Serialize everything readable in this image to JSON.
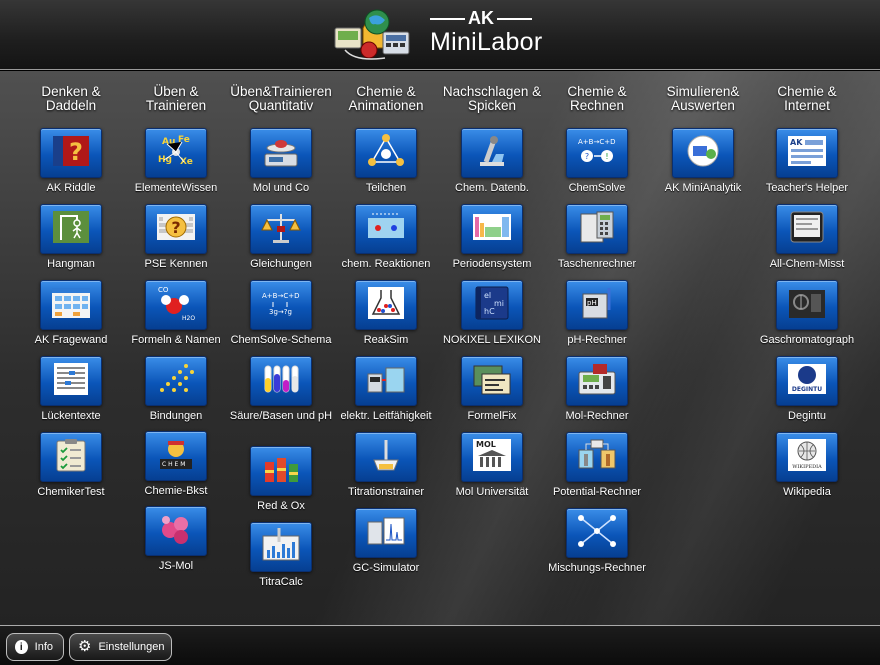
{
  "header": {
    "brand_ak": "AK",
    "brand_title": "MiniLabor"
  },
  "columns": [
    {
      "title": "Denken &\nDaddeln",
      "items": [
        {
          "label": "AK Riddle",
          "icon": "riddle-icon"
        },
        {
          "label": "Hangman",
          "icon": "hangman-icon"
        },
        {
          "label": "AK Fragewand",
          "icon": "question-wall-icon"
        },
        {
          "label": "Lückentexte",
          "icon": "cloze-text-icon"
        },
        {
          "label": "ChemikerTest",
          "icon": "clipboard-test-icon"
        }
      ]
    },
    {
      "title": "Üben &\nTrainieren",
      "items": [
        {
          "label": "ElementeWissen",
          "icon": "elements-icon"
        },
        {
          "label": "PSE Kennen",
          "icon": "pse-question-icon"
        },
        {
          "label": "Formeln & Namen",
          "icon": "molecule-formula-icon"
        },
        {
          "label": "Bindungen",
          "icon": "bonds-icon"
        },
        {
          "label": "Chemie-Bkst",
          "icon": "chem-letters-icon"
        },
        {
          "label": "JS-Mol",
          "icon": "molecule-icon"
        }
      ]
    },
    {
      "title": "Üben&Trainieren\nQuantitativ",
      "items": [
        {
          "label": "Mol und Co",
          "icon": "scale-icon"
        },
        {
          "label": "Gleichungen",
          "icon": "balance-icon"
        },
        {
          "label": "ChemSolve-Schema",
          "icon": "equation-scheme-icon"
        },
        {
          "label": "Säure/Basen und pH",
          "icon": "test-tubes-icon"
        },
        {
          "label": "Red & Ox",
          "icon": "cylinders-icon"
        },
        {
          "label": "TitraCalc",
          "icon": "titration-calc-icon"
        }
      ]
    },
    {
      "title": "Chemie &\nAnimationen",
      "items": [
        {
          "label": "Teilchen",
          "icon": "particles-icon"
        },
        {
          "label": "chem. Reaktionen",
          "icon": "reaction-icon"
        },
        {
          "label": "ReakSim",
          "icon": "flask-icon"
        },
        {
          "label": "elektr. Leitfähigkeit",
          "icon": "conductivity-icon"
        },
        {
          "label": "Titrationstrainer",
          "icon": "burette-icon"
        },
        {
          "label": "GC-Simulator",
          "icon": "gc-simulator-icon"
        }
      ]
    },
    {
      "title": "Nachschlagen &\nSpicken",
      "items": [
        {
          "label": "Chem. Datenb.",
          "icon": "microscope-icon"
        },
        {
          "label": "Periodensystem",
          "icon": "periodic-table-icon"
        },
        {
          "label": "NOKIXEL LEXIKON",
          "icon": "lexicon-book-icon"
        },
        {
          "label": "FormelFix",
          "icon": "formula-cards-icon"
        },
        {
          "label": "Mol Universität",
          "icon": "university-icon"
        }
      ]
    },
    {
      "title": "Chemie &\nRechnen",
      "items": [
        {
          "label": "ChemSolve",
          "icon": "chemsolve-icon"
        },
        {
          "label": "Taschenrechner",
          "icon": "calculator-icon"
        },
        {
          "label": "pH-Rechner",
          "icon": "ph-meter-icon"
        },
        {
          "label": "Mol-Rechner",
          "icon": "mol-calculator-icon"
        },
        {
          "label": "Potential-Rechner",
          "icon": "potential-icon"
        },
        {
          "label": "Mischungs-Rechner",
          "icon": "mixing-cross-icon"
        }
      ]
    },
    {
      "title": "Simulieren&\nAuswerten",
      "items": [
        {
          "label": "AK MiniAnalytik",
          "icon": "analytics-icon"
        }
      ]
    },
    {
      "title": "Chemie &\nInternet",
      "items": [
        {
          "label": "Teacher's Helper",
          "icon": "teachers-helper-icon"
        },
        {
          "label": "All-Chem-Misst",
          "icon": "tablet-icon"
        },
        {
          "label": "Gaschromatograph",
          "icon": "gas-chromatograph-icon"
        },
        {
          "label": "Degintu",
          "icon": "degintu-logo-icon"
        },
        {
          "label": "Wikipedia",
          "icon": "wikipedia-icon"
        }
      ]
    }
  ],
  "footer": {
    "info_label": "Info",
    "settings_label": "Einstellungen"
  },
  "colors": {
    "tile_top": "#3a8de8",
    "tile_bottom": "#063f91",
    "background": "#2e2e2e"
  }
}
